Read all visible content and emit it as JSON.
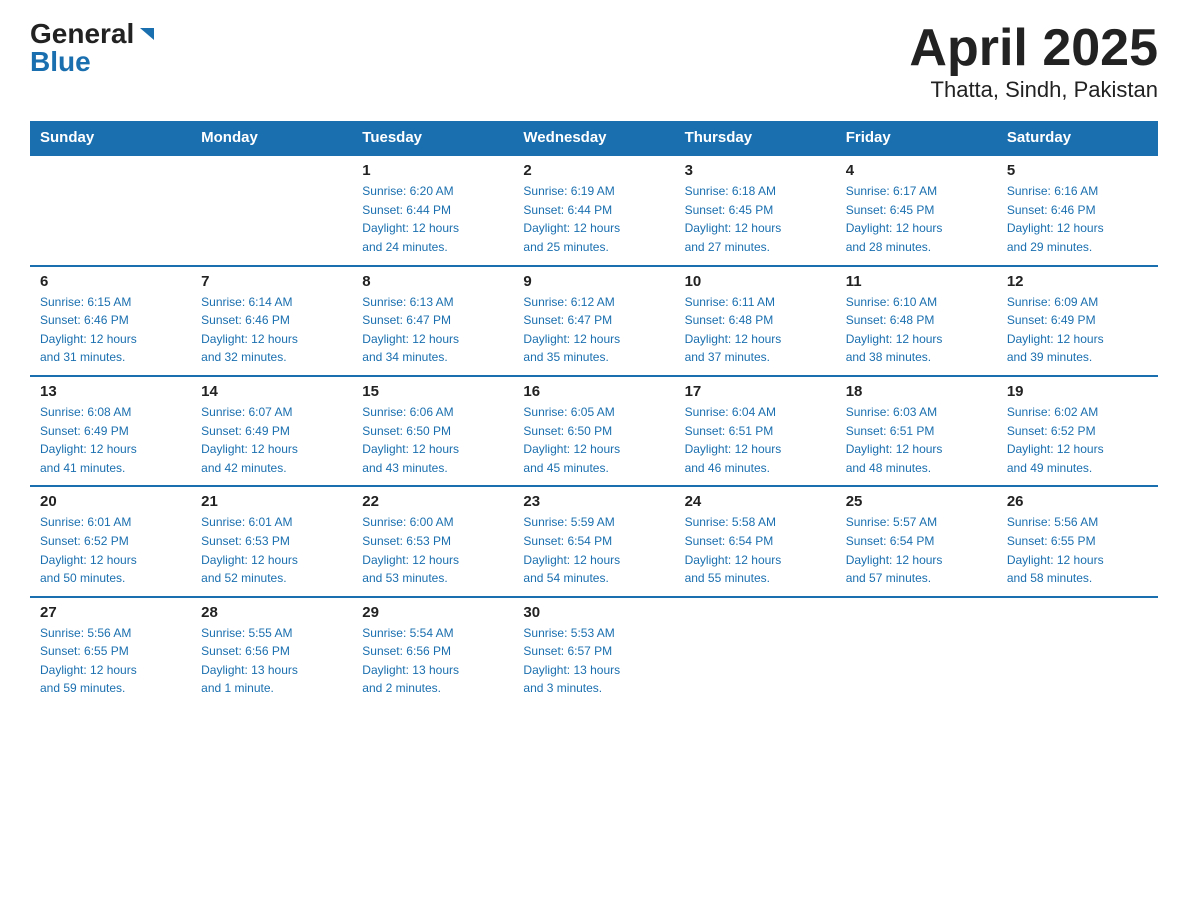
{
  "header": {
    "logo_general": "General",
    "logo_blue": "Blue",
    "title": "April 2025",
    "location": "Thatta, Sindh, Pakistan"
  },
  "weekdays": [
    "Sunday",
    "Monday",
    "Tuesday",
    "Wednesday",
    "Thursday",
    "Friday",
    "Saturday"
  ],
  "weeks": [
    [
      {
        "day": "",
        "info": ""
      },
      {
        "day": "",
        "info": ""
      },
      {
        "day": "1",
        "info": "Sunrise: 6:20 AM\nSunset: 6:44 PM\nDaylight: 12 hours\nand 24 minutes."
      },
      {
        "day": "2",
        "info": "Sunrise: 6:19 AM\nSunset: 6:44 PM\nDaylight: 12 hours\nand 25 minutes."
      },
      {
        "day": "3",
        "info": "Sunrise: 6:18 AM\nSunset: 6:45 PM\nDaylight: 12 hours\nand 27 minutes."
      },
      {
        "day": "4",
        "info": "Sunrise: 6:17 AM\nSunset: 6:45 PM\nDaylight: 12 hours\nand 28 minutes."
      },
      {
        "day": "5",
        "info": "Sunrise: 6:16 AM\nSunset: 6:46 PM\nDaylight: 12 hours\nand 29 minutes."
      }
    ],
    [
      {
        "day": "6",
        "info": "Sunrise: 6:15 AM\nSunset: 6:46 PM\nDaylight: 12 hours\nand 31 minutes."
      },
      {
        "day": "7",
        "info": "Sunrise: 6:14 AM\nSunset: 6:46 PM\nDaylight: 12 hours\nand 32 minutes."
      },
      {
        "day": "8",
        "info": "Sunrise: 6:13 AM\nSunset: 6:47 PM\nDaylight: 12 hours\nand 34 minutes."
      },
      {
        "day": "9",
        "info": "Sunrise: 6:12 AM\nSunset: 6:47 PM\nDaylight: 12 hours\nand 35 minutes."
      },
      {
        "day": "10",
        "info": "Sunrise: 6:11 AM\nSunset: 6:48 PM\nDaylight: 12 hours\nand 37 minutes."
      },
      {
        "day": "11",
        "info": "Sunrise: 6:10 AM\nSunset: 6:48 PM\nDaylight: 12 hours\nand 38 minutes."
      },
      {
        "day": "12",
        "info": "Sunrise: 6:09 AM\nSunset: 6:49 PM\nDaylight: 12 hours\nand 39 minutes."
      }
    ],
    [
      {
        "day": "13",
        "info": "Sunrise: 6:08 AM\nSunset: 6:49 PM\nDaylight: 12 hours\nand 41 minutes."
      },
      {
        "day": "14",
        "info": "Sunrise: 6:07 AM\nSunset: 6:49 PM\nDaylight: 12 hours\nand 42 minutes."
      },
      {
        "day": "15",
        "info": "Sunrise: 6:06 AM\nSunset: 6:50 PM\nDaylight: 12 hours\nand 43 minutes."
      },
      {
        "day": "16",
        "info": "Sunrise: 6:05 AM\nSunset: 6:50 PM\nDaylight: 12 hours\nand 45 minutes."
      },
      {
        "day": "17",
        "info": "Sunrise: 6:04 AM\nSunset: 6:51 PM\nDaylight: 12 hours\nand 46 minutes."
      },
      {
        "day": "18",
        "info": "Sunrise: 6:03 AM\nSunset: 6:51 PM\nDaylight: 12 hours\nand 48 minutes."
      },
      {
        "day": "19",
        "info": "Sunrise: 6:02 AM\nSunset: 6:52 PM\nDaylight: 12 hours\nand 49 minutes."
      }
    ],
    [
      {
        "day": "20",
        "info": "Sunrise: 6:01 AM\nSunset: 6:52 PM\nDaylight: 12 hours\nand 50 minutes."
      },
      {
        "day": "21",
        "info": "Sunrise: 6:01 AM\nSunset: 6:53 PM\nDaylight: 12 hours\nand 52 minutes."
      },
      {
        "day": "22",
        "info": "Sunrise: 6:00 AM\nSunset: 6:53 PM\nDaylight: 12 hours\nand 53 minutes."
      },
      {
        "day": "23",
        "info": "Sunrise: 5:59 AM\nSunset: 6:54 PM\nDaylight: 12 hours\nand 54 minutes."
      },
      {
        "day": "24",
        "info": "Sunrise: 5:58 AM\nSunset: 6:54 PM\nDaylight: 12 hours\nand 55 minutes."
      },
      {
        "day": "25",
        "info": "Sunrise: 5:57 AM\nSunset: 6:54 PM\nDaylight: 12 hours\nand 57 minutes."
      },
      {
        "day": "26",
        "info": "Sunrise: 5:56 AM\nSunset: 6:55 PM\nDaylight: 12 hours\nand 58 minutes."
      }
    ],
    [
      {
        "day": "27",
        "info": "Sunrise: 5:56 AM\nSunset: 6:55 PM\nDaylight: 12 hours\nand 59 minutes."
      },
      {
        "day": "28",
        "info": "Sunrise: 5:55 AM\nSunset: 6:56 PM\nDaylight: 13 hours\nand 1 minute."
      },
      {
        "day": "29",
        "info": "Sunrise: 5:54 AM\nSunset: 6:56 PM\nDaylight: 13 hours\nand 2 minutes."
      },
      {
        "day": "30",
        "info": "Sunrise: 5:53 AM\nSunset: 6:57 PM\nDaylight: 13 hours\nand 3 minutes."
      },
      {
        "day": "",
        "info": ""
      },
      {
        "day": "",
        "info": ""
      },
      {
        "day": "",
        "info": ""
      }
    ]
  ]
}
